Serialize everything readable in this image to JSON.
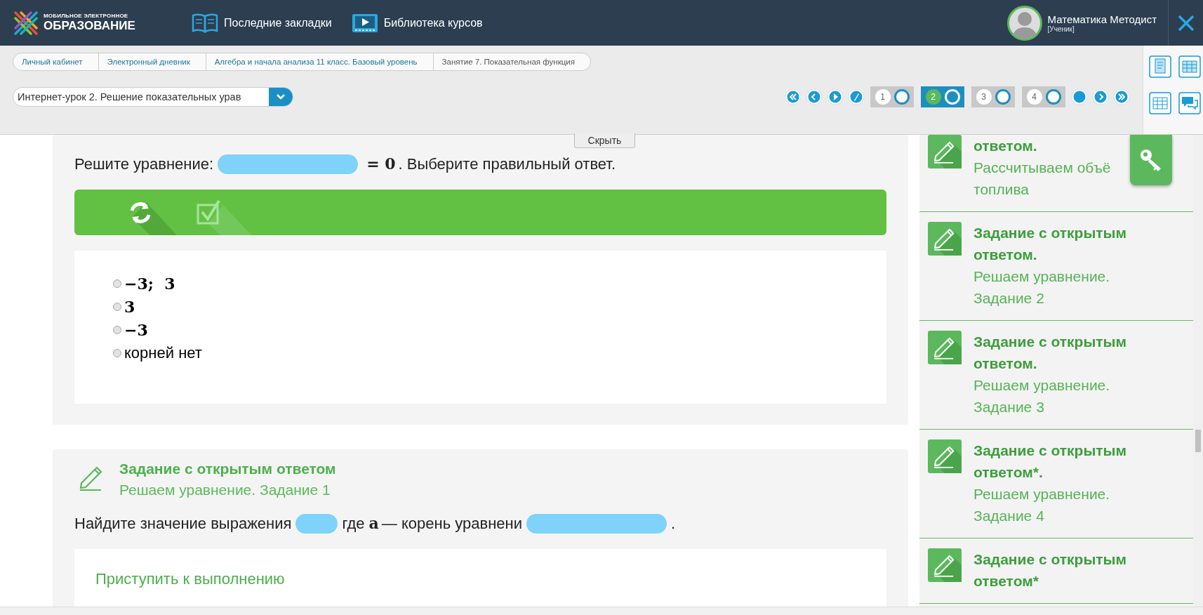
{
  "header": {
    "logo": {
      "line_1": "МОБИЛЬНОЕ ЭЛЕКТРОННОЕ",
      "line_2": "ОБРАЗОВАНИЕ"
    },
    "nav": [
      {
        "label": "Последние закладки",
        "kind": "book"
      },
      {
        "label": "Библиотека курсов",
        "kind": "video"
      }
    ],
    "user": {
      "name": "Математика Методист",
      "role": "[Ученик]"
    }
  },
  "breadcrumbs": [
    {
      "label": "Личный кабинет",
      "current": false
    },
    {
      "label": "Электронный дневник",
      "current": false
    },
    {
      "label": "Алгебра и начала анализа 11 класс. Базовый уровень",
      "current": false
    },
    {
      "label": "Занятие 7. Показательная функция",
      "current": true
    }
  ],
  "lesson_select": {
    "value": "Интернет-урок 2. Решение показательных урав"
  },
  "steps": [
    {
      "label": "1",
      "selected": false
    },
    {
      "label": "2",
      "selected": true
    },
    {
      "label": "3",
      "selected": false
    },
    {
      "label": "4",
      "selected": false
    }
  ],
  "hide_button": "Скрыть",
  "tasks": [
    {
      "kind": "choice",
      "question": [
        {
          "kind": "text",
          "text": "Решите уравнение:"
        },
        {
          "kind": "redaction"
        },
        {
          "kind": "math",
          "text": "= 0"
        },
        {
          "kind": "text",
          "text": ". Выберите правильный ответ."
        }
      ],
      "options": [
        {
          "kind": "math",
          "text": "−3;  3",
          "selected": false
        },
        {
          "kind": "math",
          "text": "3",
          "selected": false
        },
        {
          "kind": "math",
          "text": "−3",
          "selected": false
        },
        {
          "kind": "text",
          "text": "корней нет",
          "selected": false
        }
      ]
    },
    {
      "kind": "open",
      "title": "Задание с открытым ответом",
      "subtitle": "Решаем уравнение. Задание 1",
      "question": [
        {
          "kind": "text",
          "text": "Найдите значение выражения"
        },
        {
          "kind": "redaction"
        },
        {
          "kind": "text",
          "text": "где"
        },
        {
          "kind": "math",
          "text": "a"
        },
        {
          "kind": "text",
          "text": "— корень уравнени"
        },
        {
          "kind": "redaction"
        },
        {
          "kind": "text",
          "text": "."
        }
      ],
      "action": "Приступить к выполнению"
    }
  ],
  "sidebar": {
    "items": [
      {
        "title": "ответом.",
        "description": "Рассчитываем объё топлива"
      },
      {
        "title": "Задание с открытым ответом.",
        "description": "Решаем уравнение. Задание 2"
      },
      {
        "title": "Задание с открытым ответом.",
        "description": "Решаем уравнение. Задание 3"
      },
      {
        "title": "Задание с открытым ответом*.",
        "description": "Решаем уравнение. Задание 4"
      },
      {
        "title": "Задание с открытым ответом*"
      }
    ]
  }
}
